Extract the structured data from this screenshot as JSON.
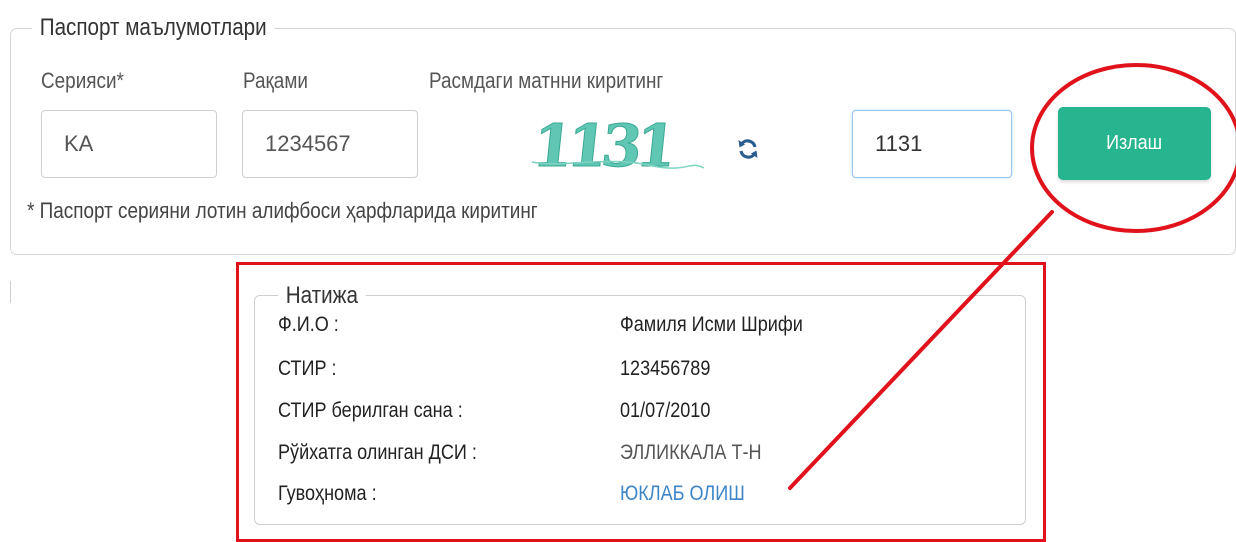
{
  "passport": {
    "legend": "Паспорт маълумотлари",
    "series_label": "Серияси*",
    "number_label": "Рақами",
    "captcha_label": "Расмдаги матнни киритинг",
    "series_value": "KA",
    "number_value": "1234567",
    "captcha_image_text": "1131",
    "captcha_value": "1131",
    "search_button": "Излаш",
    "note": "* Паспорт серияни лотин алифбоси ҳарфларида киритинг"
  },
  "result": {
    "legend": "Натижа",
    "rows": [
      {
        "label": "Ф.И.О :",
        "value": "Фамиля Исми Шрифи"
      },
      {
        "label": "СТИР :",
        "value": "123456789"
      },
      {
        "label": "СТИР берилган сана :",
        "value": "01/07/2010"
      },
      {
        "label": "Рўйхатга олинган ДСИ :",
        "value": "ЭЛЛИККАЛА Т-Н"
      },
      {
        "label": "Гувоҳнома :",
        "value": "ЮКЛАБ ОЛИШ"
      }
    ]
  },
  "colors": {
    "accent": "#26b58f",
    "annotation": "#e0121b",
    "link": "#3c86c8",
    "captcha": "#5fc7b3"
  },
  "icons": {
    "refresh": "refresh-icon"
  }
}
